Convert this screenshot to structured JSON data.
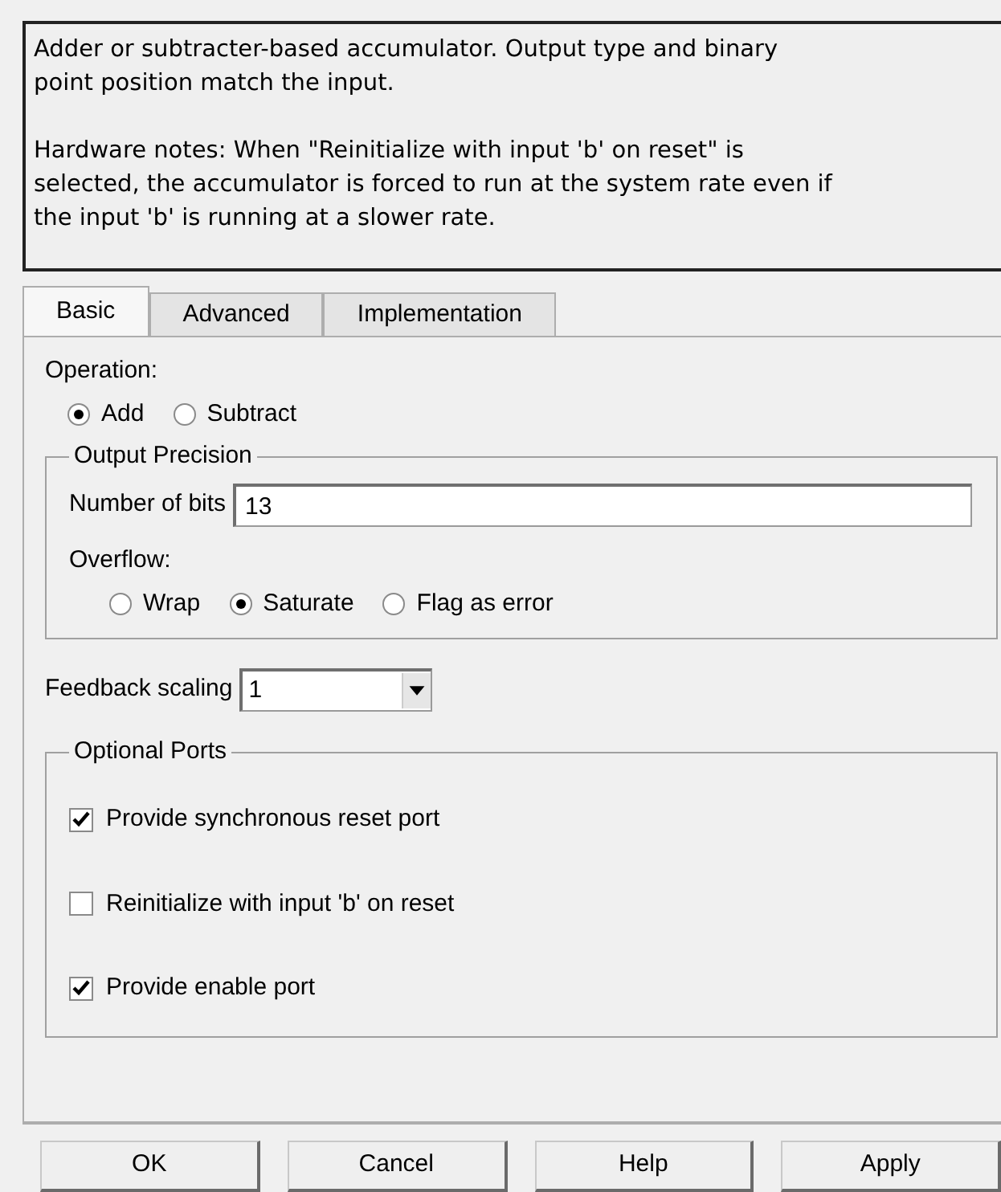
{
  "description": {
    "paragraphs": [
      "Adder or subtracter-based accumulator. Output type and binary\npoint position match the input.",
      "Hardware notes: When \"Reinitialize with input 'b' on reset\" is\nselected, the accumulator is forced to run at the system rate even if\nthe input 'b' is running at a slower rate."
    ]
  },
  "tabs": [
    {
      "label": "Basic",
      "selected": true
    },
    {
      "label": "Advanced",
      "selected": false
    },
    {
      "label": "Implementation",
      "selected": false
    }
  ],
  "operation": {
    "label": "Operation:",
    "options": [
      {
        "label": "Add",
        "selected": true
      },
      {
        "label": "Subtract",
        "selected": false
      }
    ]
  },
  "output_precision": {
    "title": "Output Precision",
    "bits_label": "Number of bits",
    "bits_value": "13",
    "overflow_label": "Overflow:",
    "overflow_options": [
      {
        "label": "Wrap",
        "selected": false
      },
      {
        "label": "Saturate",
        "selected": true
      },
      {
        "label": "Flag as error",
        "selected": false
      }
    ]
  },
  "feedback_scaling": {
    "label": "Feedback scaling",
    "value": "1"
  },
  "optional_ports": {
    "title": "Optional Ports",
    "items": [
      {
        "label": "Provide synchronous reset port",
        "checked": true
      },
      {
        "label": "Reinitialize with input 'b' on reset",
        "checked": false
      },
      {
        "label": "Provide enable port",
        "checked": true
      }
    ]
  },
  "buttons": [
    "OK",
    "Cancel",
    "Help",
    "Apply"
  ]
}
